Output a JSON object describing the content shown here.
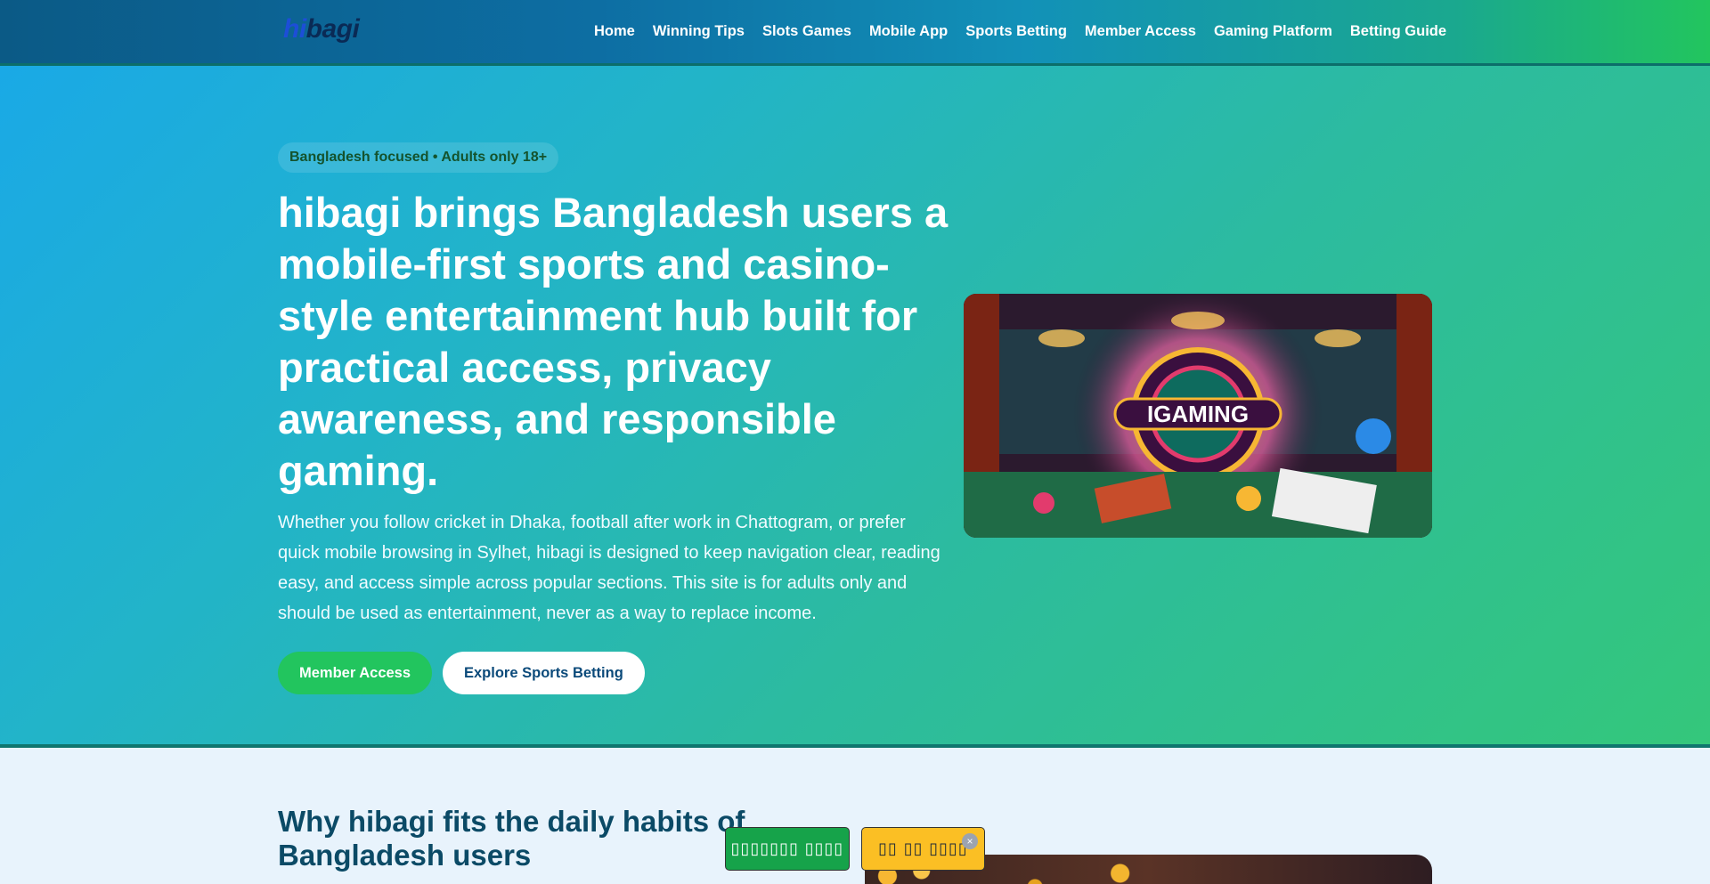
{
  "header": {
    "logo_prefix": "hi",
    "logo_suffix": "bagi",
    "nav": [
      {
        "label": "Home"
      },
      {
        "label": "Winning Tips"
      },
      {
        "label": "Slots Games"
      },
      {
        "label": "Mobile App"
      },
      {
        "label": "Sports Betting"
      },
      {
        "label": "Member Access"
      },
      {
        "label": "Gaming Platform"
      },
      {
        "label": "Betting Guide"
      }
    ]
  },
  "hero": {
    "badge": "Bangladesh focused • Adults only 18+",
    "title": "hibagi brings Bangladesh users a mobile-first sports and casino-style entertainment hub built for practical access, privacy awareness, and responsible gaming.",
    "description": "Whether you follow cricket in Dhaka, football after work in Chattogram, or prefer quick mobile browsing in Sylhet, hibagi is designed to keep navigation clear, reading easy, and access simple across popular sections. This site is for adults only and should be used as entertainment, never as a way to replace income.",
    "primary_button": "Member Access",
    "secondary_button": "Explore Sports Betting",
    "image_text": "IGAMING"
  },
  "section2": {
    "title": "Why hibagi fits the daily habits of Bangladesh users"
  },
  "floating": {
    "green_label": "▯▯▯▯▯▯▯ ▯▯▯▯",
    "yellow_label": "▯▯ ▯▯ ▯▯▯▯",
    "close": "×"
  },
  "colors": {
    "header_start": "#0b5a86",
    "header_end": "#22c55e",
    "hero_start": "#1aa9e6",
    "hero_end": "#34c77b",
    "primary_button": "#22c55e",
    "section2_title": "#0b4a66"
  }
}
